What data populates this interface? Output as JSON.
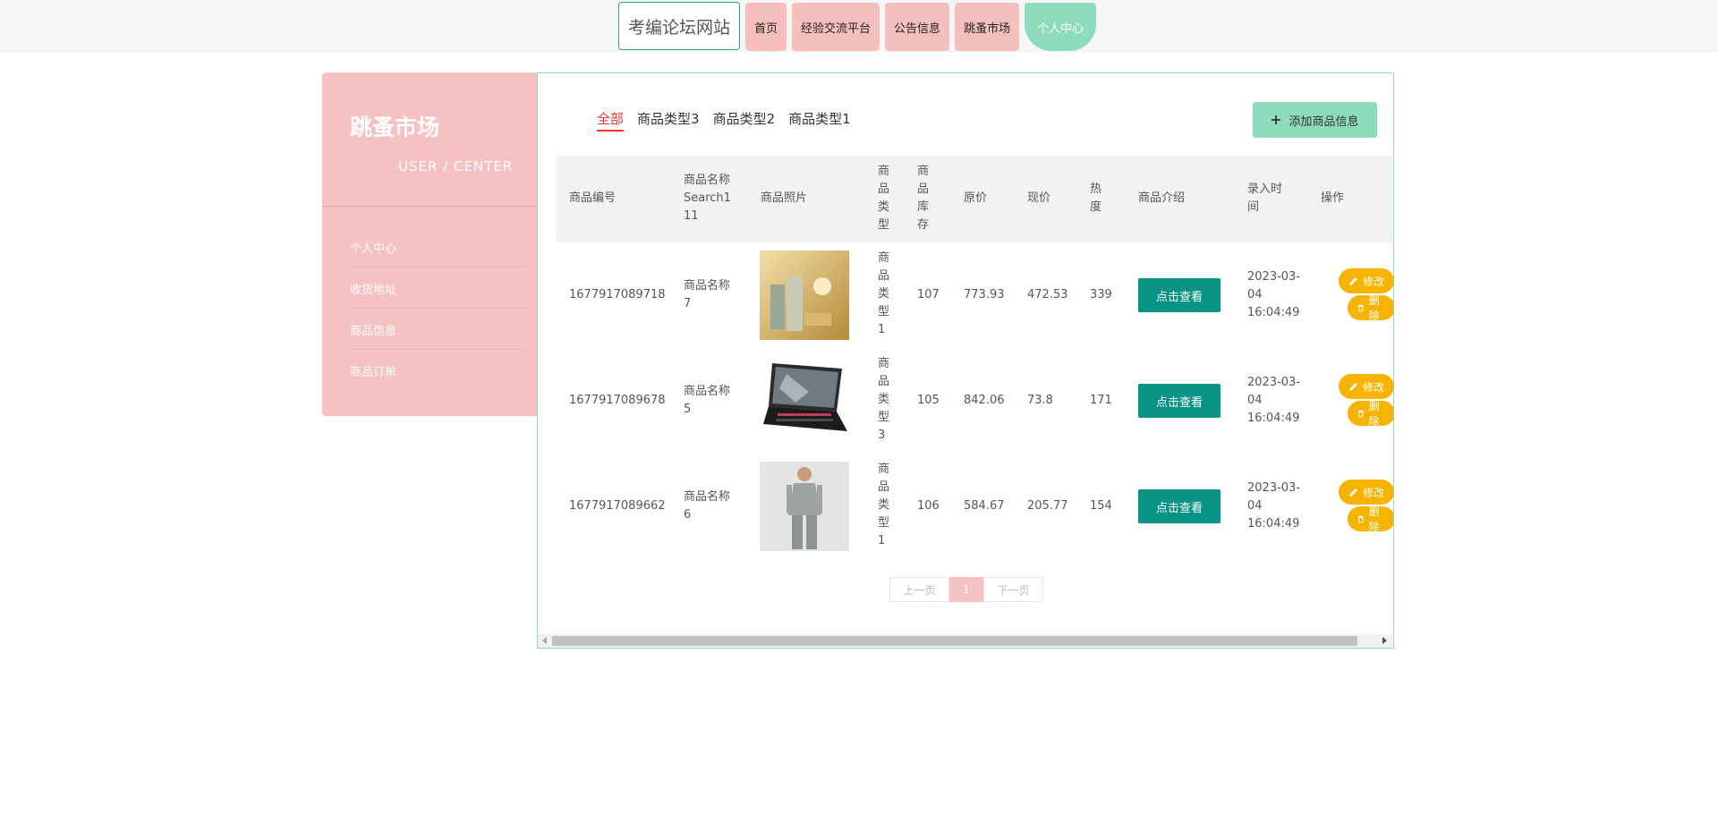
{
  "nav": {
    "site_title": "考编论坛网站",
    "items": [
      "首页",
      "经验交流平台",
      "公告信息",
      "跳蚤市场",
      "个人中心"
    ]
  },
  "sidebar": {
    "title": "跳蚤市场",
    "subtitle": "USER / CENTER",
    "items": [
      "个人中心",
      "收货地址",
      "商品信息",
      "商品订单"
    ]
  },
  "tabs": [
    "全部",
    "商品类型3",
    "商品类型2",
    "商品类型1"
  ],
  "add_button": "添加商品信息",
  "table": {
    "headers": {
      "id": "商品编号",
      "name": "商品名称Search111",
      "photo": "商品照片",
      "type": "商品类型",
      "stock": "商品库存",
      "orig": "原价",
      "price": "现价",
      "heat": "热度",
      "intro": "商品介绍",
      "time": "录入时间",
      "ops": "操作"
    },
    "rows": [
      {
        "id": "1677917089718",
        "name": "商品名称7",
        "type": "商品类型1",
        "stock": "107",
        "orig": "773.93",
        "price": "472.53",
        "heat": "339",
        "time": "2023-03-04 16:04:49"
      },
      {
        "id": "1677917089678",
        "name": "商品名称5",
        "type": "商品类型3",
        "stock": "105",
        "orig": "842.06",
        "price": "73.8",
        "heat": "171",
        "time": "2023-03-04 16:04:49"
      },
      {
        "id": "1677917089662",
        "name": "商品名称6",
        "type": "商品类型1",
        "stock": "106",
        "orig": "584.67",
        "price": "205.77",
        "heat": "154",
        "time": "2023-03-04 16:04:49"
      }
    ],
    "view_label": "点击查看",
    "edit_label": "修改",
    "delete_label": "删除"
  },
  "pager": {
    "prev": "上一页",
    "current": "1",
    "next": "下一页"
  },
  "colors": {
    "pink": "#f6c1c2",
    "mint": "#8fdbbd",
    "teal": "#089484",
    "amber": "#f6b400"
  }
}
